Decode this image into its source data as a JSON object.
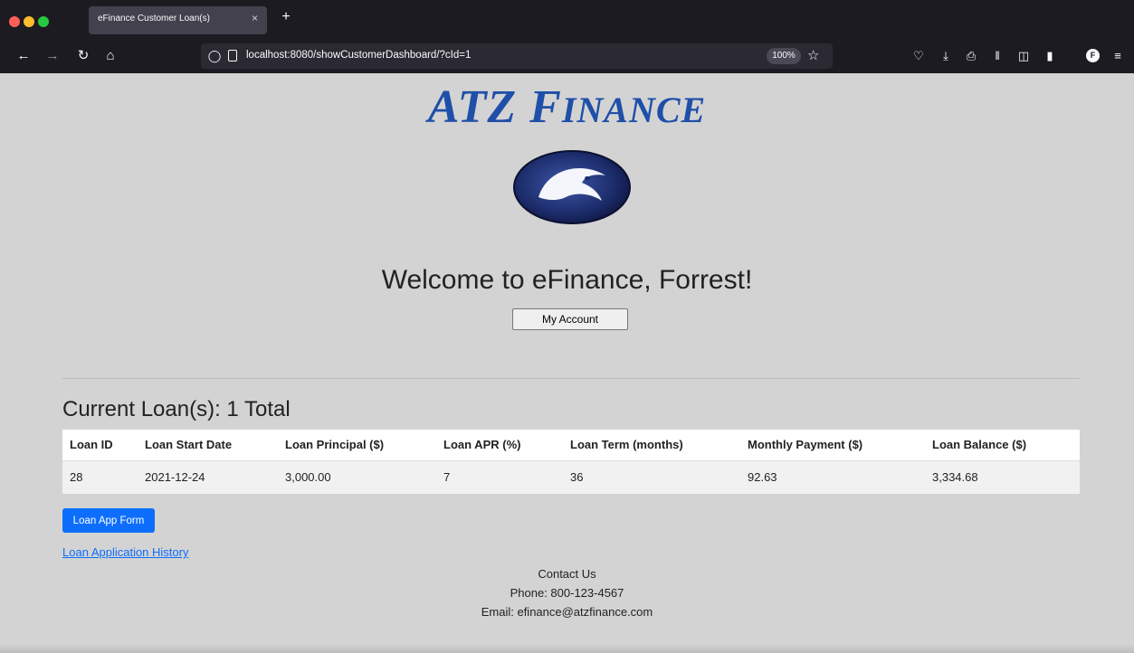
{
  "browser": {
    "tab_title": "eFinance Customer Loan(s)",
    "tab_close": "×",
    "new_tab": "+",
    "url": "localhost:8080/showCustomerDashboard/?cId=1",
    "zoom": "100%",
    "profile_initial": "F"
  },
  "header": {
    "logo_text_big": "ATZ F",
    "logo_text_small": "INANCE"
  },
  "welcome": {
    "title": "Welcome to eFinance, Forrest!",
    "account_button": "My Account"
  },
  "loans": {
    "heading": "Current Loan(s): 1 Total",
    "columns": [
      "Loan ID",
      "Loan Start Date",
      "Loan Principal ($)",
      "Loan APR (%)",
      "Loan Term (months)",
      "Monthly Payment ($)",
      "Loan Balance ($)"
    ],
    "rows": [
      [
        "28",
        "2021-12-24",
        "3,000.00",
        "7",
        "36",
        "92.63",
        "3,334.68"
      ]
    ]
  },
  "actions": {
    "loan_app_button": "Loan App Form",
    "history_link": "Loan Application History"
  },
  "footer": {
    "contact": "Contact Us",
    "phone": "Phone: 800-123-4567",
    "email": "Email: efinance@atzfinance.com"
  },
  "colors": {
    "page_bg": "#d3d3d3",
    "logo_blue": "#1f4fa8",
    "primary_button": "#0d6efd",
    "link": "#0d6efd"
  }
}
